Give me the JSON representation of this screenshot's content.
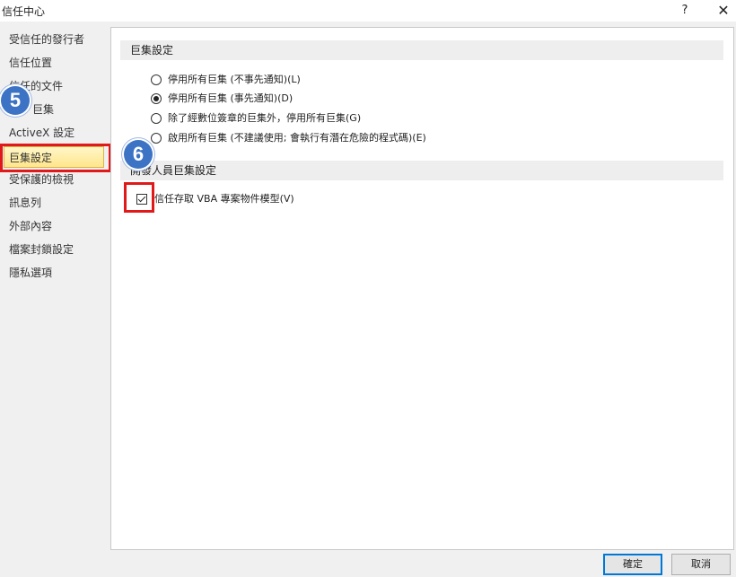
{
  "window": {
    "title": "信任中心",
    "help_label": "?",
    "close_label": "✕"
  },
  "sidebar": {
    "items": [
      {
        "label": "受信任的發行者"
      },
      {
        "label": "信任位置"
      },
      {
        "label": "信任的文件"
      },
      {
        "label": "巨集"
      },
      {
        "label": "ActiveX 設定"
      },
      {
        "label": "巨集設定",
        "selected": true
      },
      {
        "label": "受保護的檢視"
      },
      {
        "label": "訊息列"
      },
      {
        "label": "外部內容"
      },
      {
        "label": "檔案封鎖設定"
      },
      {
        "label": "隱私選項"
      }
    ]
  },
  "main": {
    "macro_section_title": "巨集設定",
    "radio_options": [
      {
        "label": "停用所有巨集 (不事先通知)(L)",
        "selected": false
      },
      {
        "label": "停用所有巨集 (事先通知)(D)",
        "selected": true
      },
      {
        "label": "除了經數位簽章的巨集外，停用所有巨集(G)",
        "selected": false
      },
      {
        "label": "啟用所有巨集 (不建議使用; 會執行有潛在危險的程式碼)(E)",
        "selected": false
      }
    ],
    "developer_section_title": "開發人員巨集設定",
    "trust_vba_label": "信任存取 VBA 專案物件模型(V)",
    "trust_vba_checked": true
  },
  "footer": {
    "ok_label": "確定",
    "cancel_label": "取消"
  },
  "annotations": {
    "step5": "5",
    "step6": "6",
    "badge_color": "#3c73c4",
    "highlight_color": "#e01a1a"
  }
}
